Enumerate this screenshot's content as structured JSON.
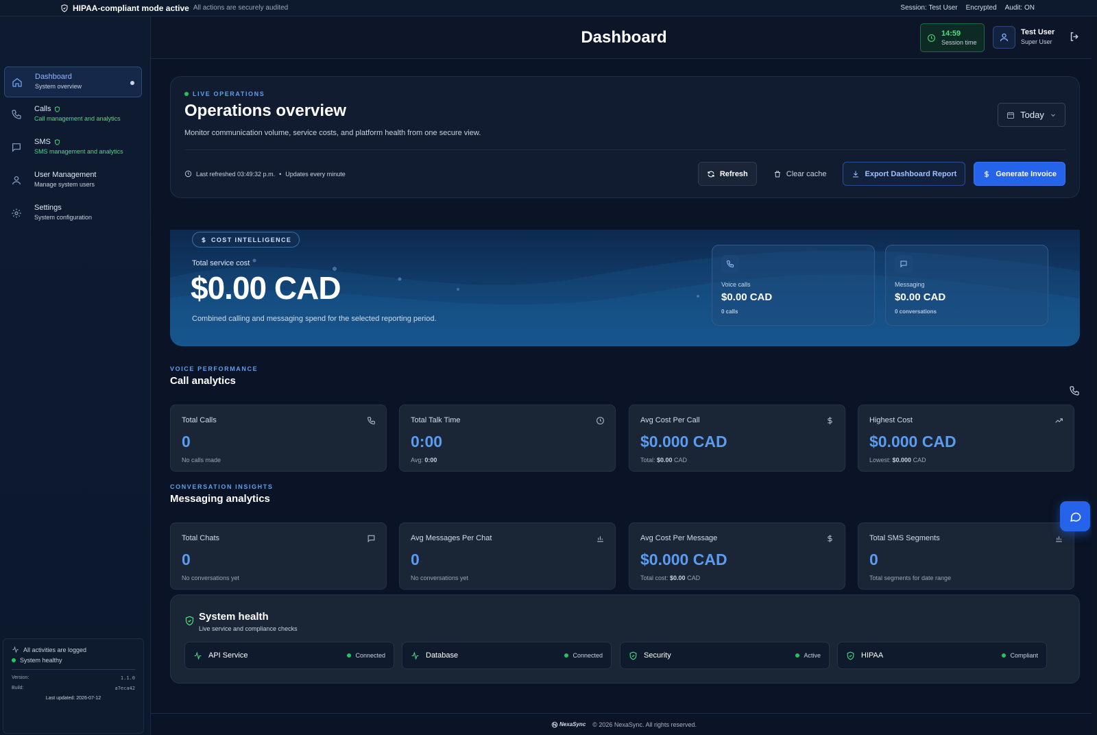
{
  "banner": {
    "title": "HIPAA-compliant mode active",
    "subtitle": "All actions are securely audited",
    "session": "Session: Test User",
    "encrypted": "Encrypted",
    "audit": "Audit: ON"
  },
  "sidebar": {
    "items": [
      {
        "label": "Dashboard",
        "desc": "System overview",
        "icon": "home-icon"
      },
      {
        "label": "Calls",
        "desc": "Call management and analytics",
        "icon": "phone-icon"
      },
      {
        "label": "SMS",
        "desc": "SMS management and analytics",
        "icon": "message-icon"
      },
      {
        "label": "User Management",
        "desc": "Manage system users",
        "icon": "user-icon"
      },
      {
        "label": "Settings",
        "desc": "System configuration",
        "icon": "gear-icon"
      }
    ],
    "status": {
      "logged": "All activities are logged",
      "healthy": "System healthy",
      "version_label": "Version:",
      "version": "1.1.0",
      "build_label": "Build:",
      "build": "a7eca42",
      "updated": "Last updated: 2026-07-12"
    }
  },
  "header": {
    "title": "Dashboard",
    "session_time": "14:59",
    "session_label": "Session time",
    "user_name": "Test User",
    "user_role": "Super User"
  },
  "ops": {
    "eyebrow": "LIVE OPERATIONS",
    "title": "Operations overview",
    "subtitle": "Monitor communication volume, service costs, and platform health from one secure view.",
    "range": "Today",
    "last_refreshed": "Last refreshed 03:49:32 p.m.",
    "bullet": "•",
    "updates": "Updates every minute",
    "buttons": {
      "refresh": "Refresh",
      "clear_cache": "Clear cache",
      "export": "Export Dashboard Report",
      "invoice": "Generate Invoice"
    }
  },
  "cost": {
    "pill": "COST INTELLIGENCE",
    "label": "Total service cost",
    "value": "$0.00 CAD",
    "desc": "Combined calling and messaging spend for the selected reporting period.",
    "voice": {
      "label": "Voice calls",
      "value": "$0.00 CAD",
      "sub": "0 calls"
    },
    "messaging": {
      "label": "Messaging",
      "value": "$0.00 CAD",
      "sub": "0 conversations"
    }
  },
  "calls": {
    "eyebrow": "VOICE PERFORMANCE",
    "title": "Call analytics",
    "cards": [
      {
        "label": "Total Calls",
        "value": "0",
        "sub": "No calls made",
        "icon": "phone-icon"
      },
      {
        "label": "Total Talk Time",
        "value": "0:00",
        "sub_prefix": "Avg: ",
        "sub_bold": "0:00",
        "sub_suffix": "",
        "icon": "clock-icon"
      },
      {
        "label": "Avg Cost Per Call",
        "value": "$0.000 CAD",
        "sub_prefix": "Total: ",
        "sub_bold": "$0.00",
        "sub_suffix": " CAD",
        "icon": "dollar-icon"
      },
      {
        "label": "Highest Cost",
        "value": "$0.000 CAD",
        "sub_prefix": "Lowest: ",
        "sub_bold": "$0.000",
        "sub_suffix": " CAD",
        "icon": "trending-up-icon"
      }
    ]
  },
  "messaging": {
    "eyebrow": "CONVERSATION INSIGHTS",
    "title": "Messaging analytics",
    "cards": [
      {
        "label": "Total Chats",
        "value": "0",
        "sub": "No conversations yet",
        "icon": "message-icon"
      },
      {
        "label": "Avg Messages Per Chat",
        "value": "0",
        "sub": "No conversations yet",
        "icon": "bar-chart-icon"
      },
      {
        "label": "Avg Cost Per Message",
        "value": "$0.000 CAD",
        "sub_prefix": "Total cost: ",
        "sub_bold": "$0.00",
        "sub_suffix": " CAD",
        "icon": "dollar-icon"
      },
      {
        "label": "Total SMS Segments",
        "value": "0",
        "sub": "Total segments for date range",
        "icon": "bar-chart-icon"
      }
    ]
  },
  "health": {
    "title": "System health",
    "subtitle": "Live service and compliance checks",
    "items": [
      {
        "name": "API Service",
        "status": "Connected",
        "icon": "activity-icon"
      },
      {
        "name": "Database",
        "status": "Connected",
        "icon": "activity-icon"
      },
      {
        "name": "Security",
        "status": "Active",
        "icon": "shield-icon"
      },
      {
        "name": "HIPAA",
        "status": "Compliant",
        "icon": "shield-icon"
      }
    ]
  },
  "footer": {
    "brand": "NexaSync",
    "copyright": "© 2026 NexaSync. All rights reserved."
  },
  "colors": {
    "background": "#0b1426",
    "accent": "#2563eb",
    "stat_value": "#5b9cf0",
    "success": "#22c55e"
  }
}
